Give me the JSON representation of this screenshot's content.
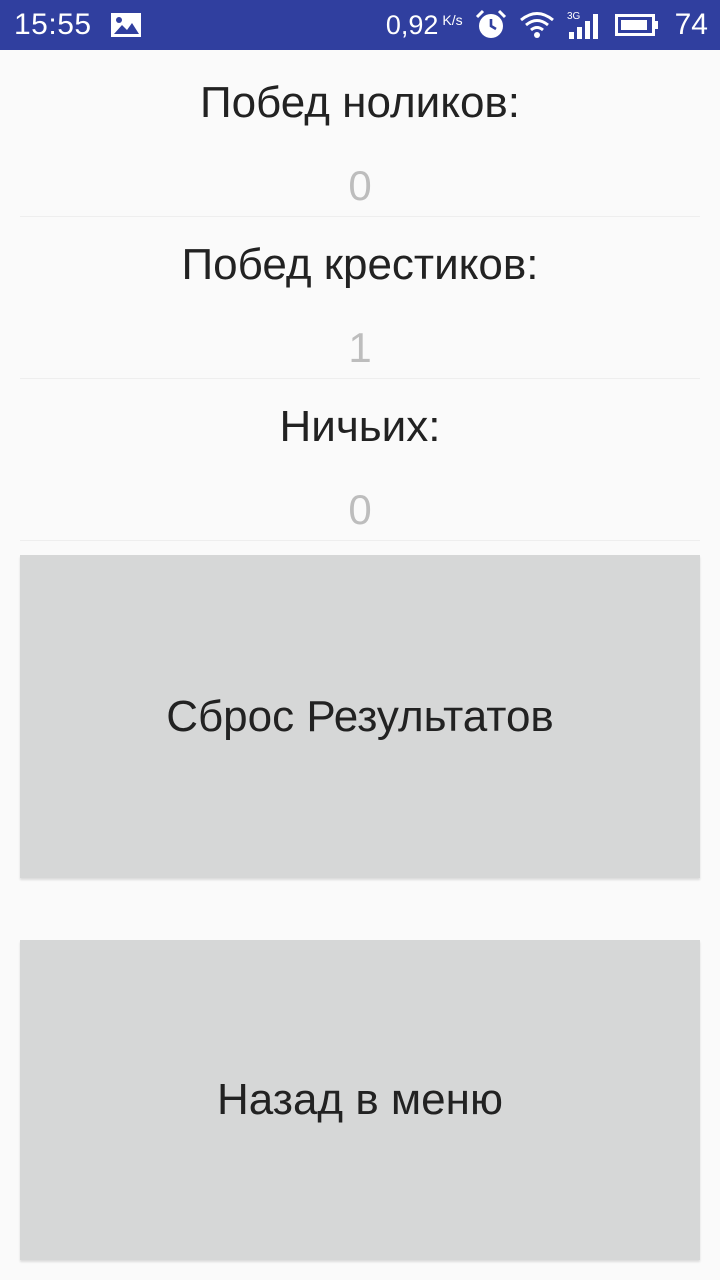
{
  "status_bar": {
    "time": "15:55",
    "gallery_notification_icon": "image-icon",
    "network_speed": "0,92",
    "network_speed_unit": "K/s",
    "alarm_icon": "alarm-clock-icon",
    "wifi_icon": "wifi-icon",
    "signal_icon": "signal-3g-icon",
    "network_type": "3G",
    "battery_icon": "battery-icon",
    "battery_level": "74",
    "background_color": "#303f9f"
  },
  "stats": {
    "noughts_label": "Побед ноликов:",
    "noughts_value": "0",
    "crosses_label": "Побед крестиков:",
    "crosses_value": "1",
    "draws_label": "Ничьих:",
    "draws_value": "0"
  },
  "buttons": {
    "reset_label": "Сброс Результатов",
    "back_label": "Назад в меню"
  }
}
